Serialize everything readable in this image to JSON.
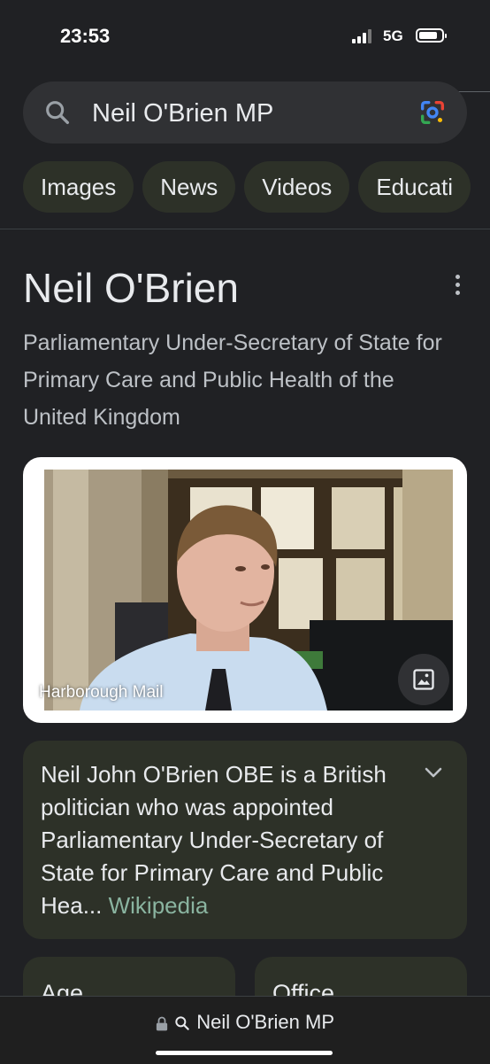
{
  "status_bar": {
    "time": "23:53",
    "network": "5G"
  },
  "search": {
    "query": "Neil O'Brien MP"
  },
  "chips": [
    "Images",
    "News",
    "Videos",
    "Educati"
  ],
  "panel": {
    "title": "Neil O'Brien",
    "subtitle": "Parliamentary Under-Secretary of State for Primary Care and Public Health of the United Kingdom",
    "image_caption": "Harborough Mail",
    "description": "Neil John O'Brien OBE is a British politician who was appointed Parliamentary Under-Secretary of State for Primary Care and Public Hea...",
    "description_source": "Wikipedia",
    "cards": [
      "Age",
      "Office"
    ]
  },
  "url_bar": {
    "text": "Neil O'Brien MP"
  }
}
